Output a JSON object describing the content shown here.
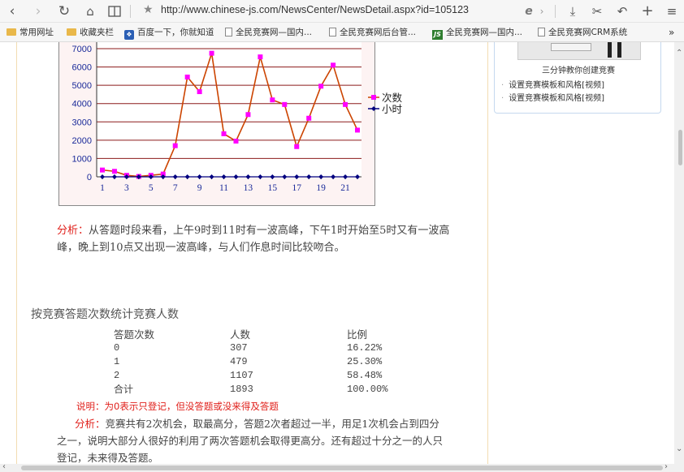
{
  "toolbar": {
    "url": "http://www.chinese-js.com/NewsCenter/NewsDetail.aspx?id=105123",
    "icons": [
      "chevron-left-icon",
      "chevron-right-icon",
      "reload-icon",
      "home-icon",
      "reader-icon",
      "star-icon",
      "ie-mode-icon",
      "download-icon",
      "cut-icon",
      "undo-icon",
      "plus-icon",
      "menu-icon"
    ]
  },
  "bookmarks": [
    {
      "label": "常用网址",
      "icon": "folder-icon"
    },
    {
      "label": "收藏夹栏",
      "icon": "folder-icon"
    },
    {
      "label": "百度一下，你就知道",
      "icon": "baidu-icon"
    },
    {
      "label": "全民竞赛网—国内...",
      "icon": "page-icon"
    },
    {
      "label": "全民竞赛网后台管...",
      "icon": "page-icon"
    },
    {
      "label": "全民竞赛网—国内...",
      "icon": "js-icon"
    },
    {
      "label": "全民竞赛网CRM系统",
      "icon": "page-icon"
    },
    {
      "label": "»",
      "icon": "more-icon"
    }
  ],
  "chart_data": {
    "type": "line",
    "x": [
      1,
      2,
      3,
      4,
      5,
      6,
      7,
      8,
      9,
      10,
      11,
      12,
      13,
      14,
      15,
      16,
      17,
      18,
      19,
      20,
      21,
      22
    ],
    "x_tick_labels": [
      "1",
      "3",
      "5",
      "7",
      "9",
      "11",
      "13",
      "15",
      "17",
      "19",
      "21"
    ],
    "ylim": [
      0,
      7000
    ],
    "y_ticks": [
      0,
      1000,
      2000,
      3000,
      4000,
      5000,
      6000,
      7000
    ],
    "grid": true,
    "legend_placement": "right",
    "series": [
      {
        "name": "次数",
        "color": "#cc4400",
        "marker_color": "#ff00ff",
        "marker": "square",
        "values": [
          370,
          300,
          80,
          20,
          80,
          150,
          1700,
          5450,
          4650,
          6750,
          2350,
          1950,
          3400,
          6550,
          4200,
          3950,
          1650,
          3200,
          4950,
          6100,
          3950,
          2550
        ]
      },
      {
        "name": "小时",
        "color": "#000080",
        "marker_color": "#000080",
        "marker": "diamond",
        "values": [
          0,
          0,
          0,
          0,
          0,
          0,
          0,
          0,
          0,
          0,
          0,
          0,
          0,
          0,
          0,
          0,
          0,
          0,
          0,
          0,
          0,
          0
        ]
      }
    ]
  },
  "analysis1": {
    "label": "分析：",
    "text": "从答题时段来看，上午9时到11时有一波高峰，下午1时开始至5时又有一波高峰，晚上到10点又出现一波高峰，与人们作息时间比较吻合。"
  },
  "section_title": "按竞赛答题次数统计竞赛人数",
  "stats_table": {
    "headers": [
      "答题次数",
      "人数",
      "比例"
    ],
    "rows": [
      [
        "0",
        "307",
        "16.22%"
      ],
      [
        "1",
        "479",
        "25.30%"
      ],
      [
        "2",
        "1107",
        "58.48%"
      ],
      [
        "合计",
        "1893",
        "100.00%"
      ]
    ]
  },
  "note": "说明：为0表示只登记，但没答题或没来得及答题",
  "analysis2": {
    "label": "分析：",
    "text": "竞赛共有2次机会，取最高分，答题2次者超过一半，用足1次机会占到四分之一，说明大部分人很好的利用了两次答题机会取得更高分。还有超过十分之一的人只登记，未来得及答题。"
  },
  "sidebar": {
    "caption": "三分钟教你创建竞赛",
    "links": [
      "设置竞赛模板和风格[视频]",
      "设置竞赛模板和风格[视频]"
    ]
  }
}
